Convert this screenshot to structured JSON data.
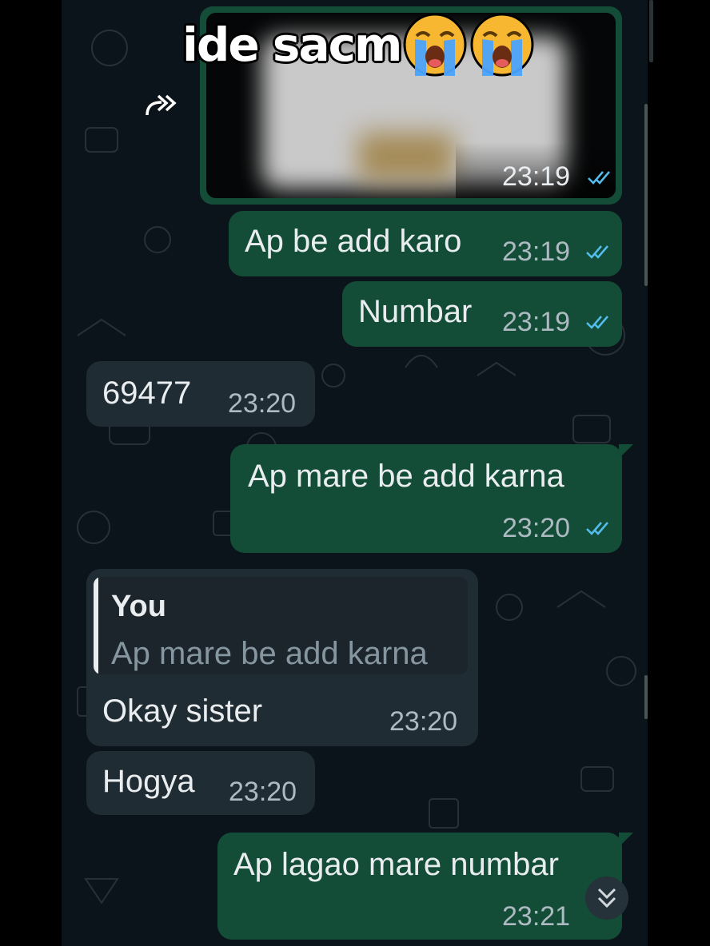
{
  "overlay": {
    "caption": "ide sacm",
    "emoji": [
      "loudly-crying-face",
      "loudly-crying-face"
    ]
  },
  "colors": {
    "outgoing": "#144d37",
    "incoming": "#202c33",
    "read_ticks": "#53bdeb",
    "background": "#0b141a"
  },
  "messages": [
    {
      "type": "image",
      "direction": "out",
      "forwarded": true,
      "time": "23:19",
      "status": "read"
    },
    {
      "type": "text",
      "direction": "out",
      "text": "Ap be add karo",
      "time": "23:19",
      "status": "read"
    },
    {
      "type": "text",
      "direction": "out",
      "text": "Numbar",
      "time": "23:19",
      "status": "read"
    },
    {
      "type": "text",
      "direction": "in",
      "text": "69477",
      "time": "23:20"
    },
    {
      "type": "text",
      "direction": "out",
      "text": "Ap mare be add karna",
      "time": "23:20",
      "status": "read"
    },
    {
      "type": "reply",
      "direction": "in",
      "quoted_author": "You",
      "quoted_text": "Ap mare be add karna",
      "text": "Okay sister",
      "time": "23:20"
    },
    {
      "type": "text",
      "direction": "in",
      "text": "Hogya",
      "time": "23:20"
    },
    {
      "type": "text",
      "direction": "out",
      "text": "Ap lagao mare numbar",
      "time": "23:21",
      "status": "read"
    }
  ],
  "controls": {
    "scroll_to_bottom_icon": "double-chevron-down-icon",
    "forward_icon": "forward-icon"
  }
}
